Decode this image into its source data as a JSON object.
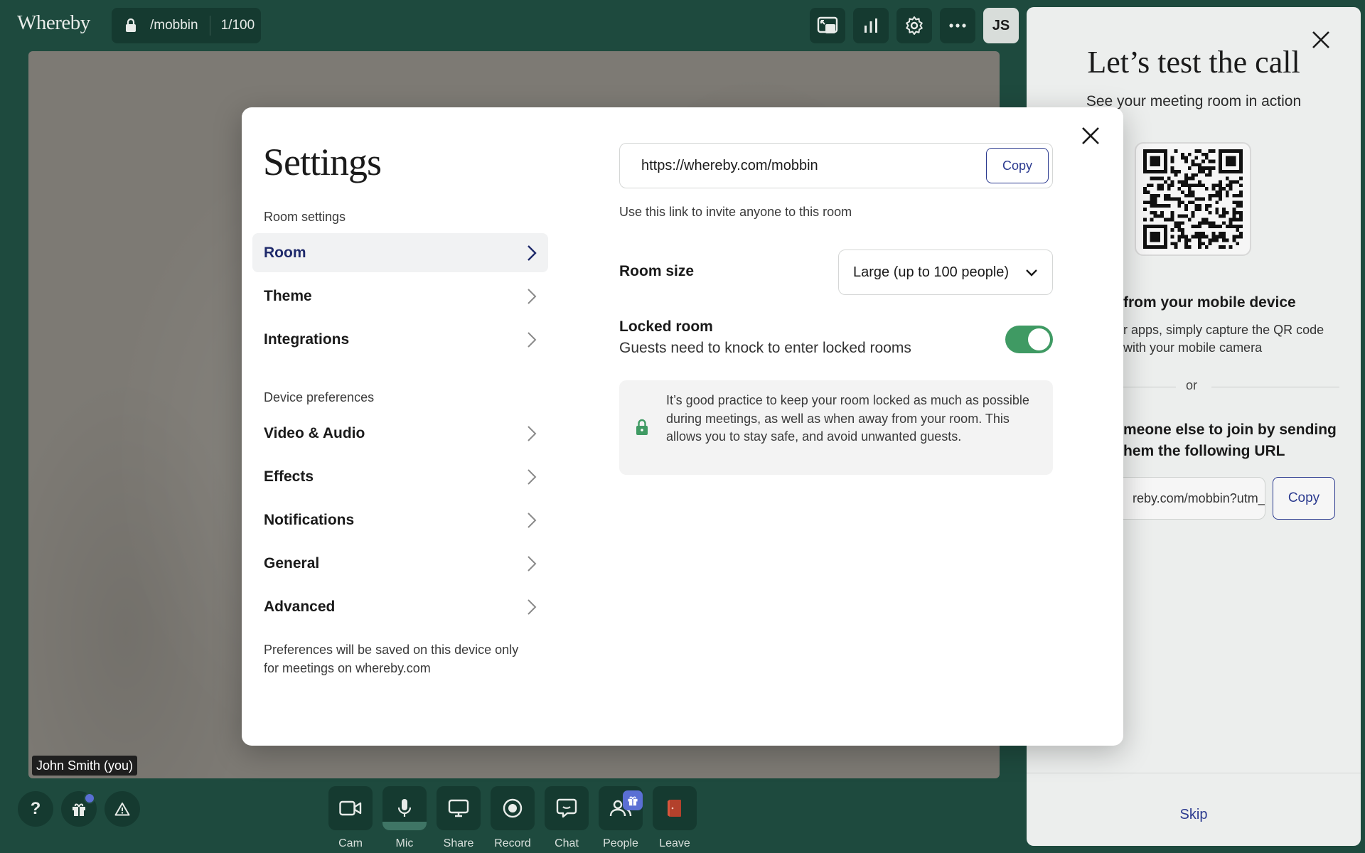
{
  "app": {
    "logo": "Whereby"
  },
  "room_pill": {
    "name": "/mobbin",
    "count": "1/100"
  },
  "top_bar": {
    "avatar_initials": "JS"
  },
  "video": {
    "name_tag": "John Smith (you)"
  },
  "toolbar": {
    "cam": "Cam",
    "mic": "Mic",
    "share": "Share",
    "record": "Record",
    "chat": "Chat",
    "people": "People",
    "leave": "Leave"
  },
  "side_panel": {
    "title": "Let’s test the call",
    "subtitle": "See your meeting room in action",
    "mobile_heading": "from your mobile device",
    "mobile_text": "r apps, simply capture the QR code with your mobile camera",
    "or": "or",
    "invite_heading": "meone else to join by sending hem the following URL",
    "invite_url": "reby.com/mobbin?utm_",
    "copy_label": "Copy",
    "skip_label": "Skip"
  },
  "settings": {
    "title": "Settings",
    "room_settings_label": "Room settings",
    "nav_room": [
      "Room",
      "Theme",
      "Integrations"
    ],
    "device_prefs_label": "Device preferences",
    "nav_device": [
      "Video & Audio",
      "Effects",
      "Notifications",
      "General",
      "Advanced"
    ],
    "prefs_note": "Preferences will be saved on this device only for meetings on whereby.com",
    "room_url": "https://whereby.com/mobbin",
    "copy_label": "Copy",
    "url_help": "Use this link to invite anyone to this room",
    "room_size_label": "Room size",
    "room_size_value": "Large (up to 100 people)",
    "locked_title": "Locked room",
    "locked_desc": "Guests need to knock to enter locked rooms",
    "locked_enabled": true,
    "info_text": "It’s good practice to keep your room locked as much as possible during meetings, as well as when away from your room. This allows you to stay safe, and avoid unwanted guests."
  },
  "colors": {
    "background": "#1e4a3e",
    "accent": "#2b3a8f",
    "toggle_on": "#3f9a63"
  }
}
